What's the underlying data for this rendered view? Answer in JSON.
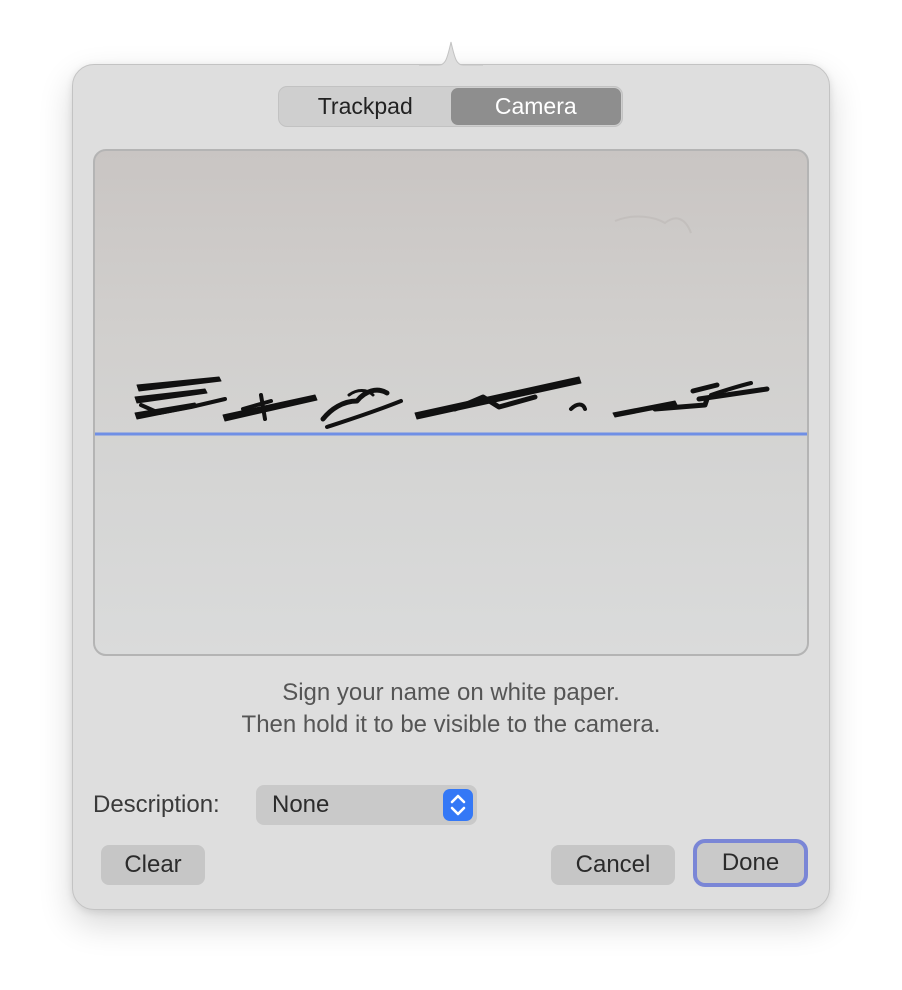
{
  "segmented_control": {
    "tabs": [
      {
        "label": "Trackpad",
        "selected": false
      },
      {
        "label": "Camera",
        "selected": true
      }
    ]
  },
  "camera_view": {
    "baseline_color": "#6f8fe5",
    "background_color": "#d3d2d1"
  },
  "instructions": {
    "line1": "Sign your name on white paper.",
    "line2": "Then hold it to be visible to the camera."
  },
  "description": {
    "label": "Description:",
    "selected_value": "None"
  },
  "buttons": {
    "clear_label": "Clear",
    "cancel_label": "Cancel",
    "done_label": "Done"
  },
  "colors": {
    "accent": "#3478f6",
    "focus_ring": "#7a86d6",
    "panel_background": "#dedede"
  },
  "icons": {
    "stepper": "chevron-up-down-icon"
  }
}
